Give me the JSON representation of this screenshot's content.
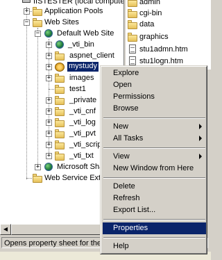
{
  "tree": {
    "root": "IISTESTER (local computer)",
    "items": [
      {
        "label": "Application Pools"
      },
      {
        "label": "Web Sites"
      },
      {
        "label": "Default Web Site"
      },
      {
        "label": "_vti_bin"
      },
      {
        "label": "aspnet_client"
      },
      {
        "label": "mystudy"
      },
      {
        "label": "images"
      },
      {
        "label": "test1"
      },
      {
        "label": "_private"
      },
      {
        "label": "_vti_cnf"
      },
      {
        "label": "_vti_log"
      },
      {
        "label": "_vti_pvt"
      },
      {
        "label": "_vti_script"
      },
      {
        "label": "_vti_txt"
      },
      {
        "label": "Microsoft SharePoint Administration"
      },
      {
        "label": "Web Service Extensions"
      }
    ]
  },
  "right_list": {
    "items": [
      {
        "label": "admin",
        "icon": "folder-icon"
      },
      {
        "label": "cgi-bin",
        "icon": "folder-icon"
      },
      {
        "label": "data",
        "icon": "folder-icon"
      },
      {
        "label": "graphics",
        "icon": "folder-icon"
      },
      {
        "label": "stu1admn.htm",
        "icon": "page-icon"
      },
      {
        "label": "stu1logn.htm",
        "icon": "page-icon"
      }
    ]
  },
  "context_menu": {
    "explore": "Explore",
    "open": "Open",
    "permissions": "Permissions",
    "browse": "Browse",
    "new": "New",
    "all_tasks": "All Tasks",
    "view": "View",
    "new_window": "New Window from Here",
    "delete": "Delete",
    "refresh": "Refresh",
    "export_list": "Export List...",
    "properties": "Properties",
    "help": "Help"
  },
  "status": {
    "text": "Opens property sheet for the current selection."
  },
  "colors": {
    "selection": "#0a246a",
    "face": "#d4d0c8"
  }
}
